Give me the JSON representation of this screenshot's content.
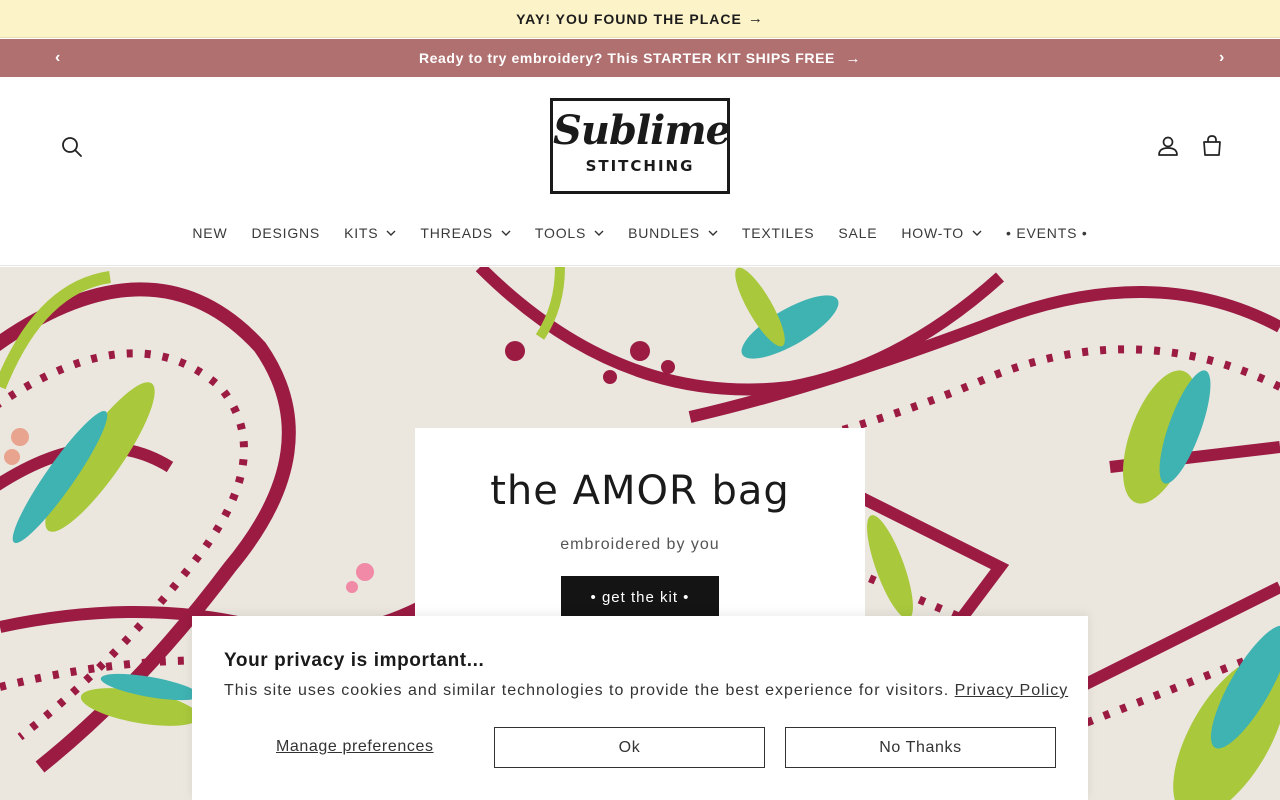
{
  "top_banner": {
    "text": "YAY! YOU FOUND THE PLACE",
    "arrow": "→"
  },
  "announcement": {
    "text": "Ready to try embroidery? This STARTER KIT SHIPS FREE",
    "arrow": "→",
    "prev_icon": "‹",
    "next_icon": "›",
    "background": "#b07070"
  },
  "header": {
    "logo": {
      "script": "Sublime",
      "caps": "STITCHING"
    }
  },
  "nav": {
    "items": [
      {
        "label": "NEW"
      },
      {
        "label": "DESIGNS"
      },
      {
        "label": "KITS"
      },
      {
        "label": "THREADS"
      },
      {
        "label": "TOOLS"
      },
      {
        "label": "BUNDLES"
      },
      {
        "label": "TEXTILES"
      },
      {
        "label": "SALE"
      },
      {
        "label": "HOW-TO"
      },
      {
        "label": "• EVENTS •"
      }
    ]
  },
  "hero": {
    "title": "the AMOR bag",
    "subtitle": "embroidered by you",
    "cta": "• get the kit •"
  },
  "cookie_banner": {
    "title": "Your privacy is important...",
    "message": "This site uses cookies and similar technologies to provide the best experience for visitors.",
    "policy_link": "Privacy Policy",
    "manage": "Manage preferences",
    "ok": "Ok",
    "no_thanks": "No Thanks"
  },
  "colors": {
    "banner_yellow": "#fdf3c9",
    "embroidery_red": "#9b1b43",
    "embroidery_green": "#a9c83c",
    "embroidery_teal": "#3fb2b2"
  }
}
